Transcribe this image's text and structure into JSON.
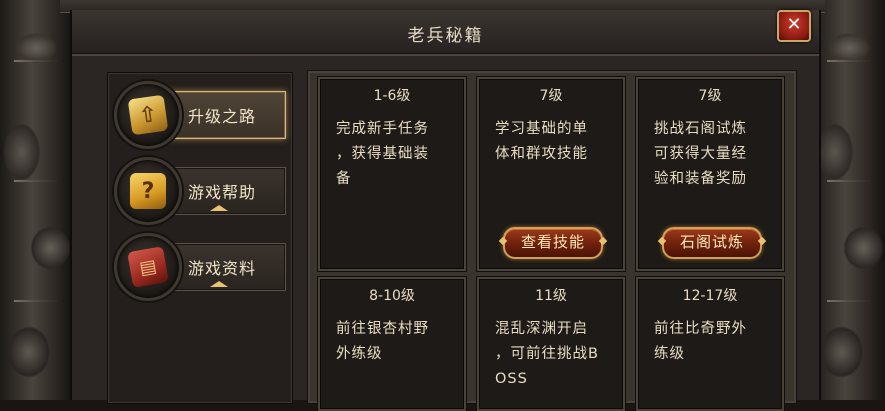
{
  "window": {
    "title": "老兵秘籍",
    "close_label": "✕"
  },
  "sidebar": {
    "items": [
      {
        "label": "升级之路",
        "icon": "upgrade-arrow-icon",
        "active": true
      },
      {
        "label": "游戏帮助",
        "icon": "question-mark-icon",
        "active": false
      },
      {
        "label": "游戏资料",
        "icon": "book-icon",
        "active": false
      }
    ]
  },
  "cards": [
    {
      "level": "1-6级",
      "desc": "完成新手任务\n，获得基础装\n备",
      "button": ""
    },
    {
      "level": "7级",
      "desc": "学习基础的单\n体和群攻技能",
      "button": "查看技能"
    },
    {
      "level": "7级",
      "desc": "挑战石阁试炼\n可获得大量经\n验和装备奖励",
      "button": "石阁试炼"
    },
    {
      "level": "8-10级",
      "desc": "前往银杏村野\n外练级",
      "button": ""
    },
    {
      "level": "11级",
      "desc": "混乱深渊开启\n，可前往挑战B\nOSS",
      "button": ""
    },
    {
      "level": "12-17级",
      "desc": "前往比奇野外\n练级",
      "button": ""
    }
  ],
  "colors": {
    "accent_gold": "#d8b778",
    "text": "#e8dcc3",
    "button_red": "#6d200c",
    "close_red": "#c62f22"
  }
}
